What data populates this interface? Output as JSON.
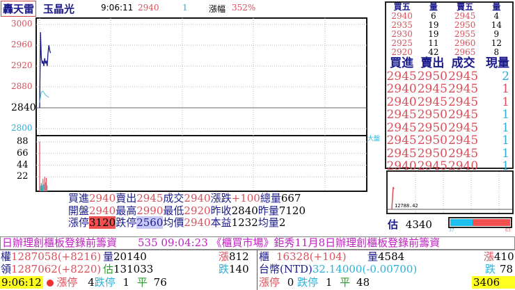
{
  "header": {
    "brand": "轟天雷",
    "stock_name": "玉晶光",
    "time": "9:06:11",
    "price": "2940",
    "volume": "1",
    "change_label": "漲幅",
    "change_pct": "352%"
  },
  "order_book": {
    "headers": [
      "買五",
      "量",
      "賣五",
      "量"
    ],
    "rows": [
      [
        "2940",
        "6",
        "2945",
        "4"
      ],
      [
        "2935",
        "19",
        "2950",
        "14"
      ],
      [
        "2930",
        "19",
        "2955",
        "9"
      ],
      [
        "2925",
        "11",
        "2960",
        "12"
      ],
      [
        "2920",
        "42",
        "2965",
        "8"
      ]
    ]
  },
  "ticks": {
    "headers": [
      "買進",
      "賣出",
      "成交",
      "現量"
    ],
    "rows": [
      [
        "2945",
        "2950",
        "2945",
        "2",
        "cyan"
      ],
      [
        "2940",
        "2945",
        "2945",
        "1",
        "red"
      ],
      [
        "2940",
        "2945",
        "2945",
        "1",
        "red"
      ],
      [
        "2945",
        "2950",
        "2945",
        "1",
        "cyan"
      ],
      [
        "2945",
        "2950",
        "2945",
        "1",
        "cyan"
      ],
      [
        "2945",
        "2950",
        "2945",
        "1",
        "cyan"
      ],
      [
        "2945",
        "2950",
        "2945",
        "1",
        "cyan"
      ],
      [
        "2940",
        "2945",
        "2940",
        "1",
        "cyan"
      ]
    ]
  },
  "chart": {
    "price_ticks": [
      "3000",
      "2960",
      "2920",
      "2880",
      "2840",
      "2800"
    ],
    "volume_ticks": [
      "88",
      "66",
      "44",
      "22"
    ],
    "market_label": "大盤",
    "price_series": [
      2840,
      2985,
      2935,
      2925,
      2930,
      2920,
      2935,
      2925,
      2930,
      2920,
      2945,
      2960,
      2950,
      2945
    ],
    "avg_series": [
      2850,
      2870,
      2872,
      2868,
      2864,
      2862,
      2860
    ],
    "volume_series": [
      88,
      5,
      10,
      6,
      18,
      8,
      22,
      12,
      20,
      6
    ],
    "colors": {
      "price": "#1a1a8c",
      "avg": "#40c0d0",
      "up": "#d9505a",
      "down": "#40c0d0"
    }
  },
  "mini_chart": {
    "label": "12788.42"
  },
  "estimate": {
    "label": "估",
    "value": "4340",
    "down_pct": 37,
    "up_pct": 63,
    "down_label": "37",
    "up_label": "63"
  },
  "info": {
    "buy_label": "買進",
    "buy": "2940",
    "sell_label": "賣出",
    "sell": "2945",
    "deal_label": "成交",
    "deal": "2940",
    "chg_label": "漲跌",
    "chg": "+100",
    "totvol_label": "總量",
    "totvol": "667",
    "open_label": "開盤",
    "open": "2940",
    "high_label": "最高",
    "high": "2990",
    "low_label": "最低",
    "low": "2920",
    "prev_label": "昨收",
    "prev": "2840",
    "prevvol_label": "昨量",
    "prevvol": "7120",
    "limup_label": "漲停",
    "limup": "3120",
    "limdn_label": "跌停",
    "limdn": "2560",
    "avg_label": "均價",
    "avg": "2940",
    "pe_label": "本益",
    "pe": "1232",
    "avgvol_label": "均量",
    "avgvol": "2"
  },
  "marquee": "日辦理創櫃板登錄前籌資　　535 09:04:23 《櫃買市場》鉅秀11月8日辦理創櫃板登錄前籌資",
  "market": {
    "twse_label": "權",
    "twse": "1287058(+8216)",
    "twse_vol_label": "量",
    "twse_vol": "20140",
    "twse_up_label": "漲",
    "twse_up": "812",
    "lead_label": "領",
    "lead": "1287062(+8220)",
    "est_label": "估",
    "est": "131033",
    "twse_dn_label": "跌",
    "twse_dn": "140",
    "clock": "9:06:12",
    "limup_label": "漲停",
    "limup": "4",
    "limdn_label": "跌停",
    "limdn": "1",
    "flat_label": "平",
    "flat": "76",
    "otc_label": "櫃",
    "otc": "16328(+104)",
    "otc_vol_label": "量",
    "otc_vol": "4584",
    "otc_up_label": "漲",
    "otc_up": "410",
    "fx_label": "台幣(NTD)",
    "fx": "32.14000(-0.00700)",
    "otc_dn_label": "跌",
    "otc_dn": "78",
    "otc_limup_label": "漲停",
    "otc_limup": "0",
    "otc_limdn_label": "跌停",
    "otc_limdn": "1",
    "otc_flat_label": "平",
    "otc_flat": "48",
    "counter": "3406"
  }
}
